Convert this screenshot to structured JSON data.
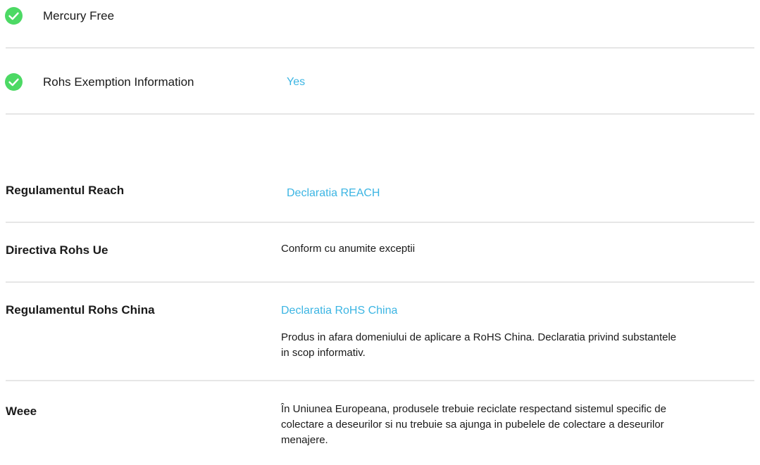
{
  "colors": {
    "check_green": "#4cd964",
    "link": "#3cb5e3",
    "divider": "#e6e6e6"
  },
  "features": [
    {
      "icon": "check-circle-icon",
      "label": "Mercury Free",
      "value": ""
    },
    {
      "icon": "check-circle-icon",
      "label": "Rohs Exemption Information",
      "value": "Yes"
    }
  ],
  "regulations": {
    "reach": {
      "label": "Regulamentul Reach",
      "link": "Declaratia REACH"
    },
    "rohs_eu": {
      "label": "Directiva Rohs Ue",
      "value": "Conform cu anumite exceptii"
    },
    "rohs_china": {
      "label": "Regulamentul Rohs China",
      "link": "Declaratia RoHS China",
      "description_lines": [
        "Produs in afara domeniului de aplicare a RoHS China. Declaratia privind substantele",
        "in scop informativ."
      ]
    },
    "weee": {
      "label": "Weee",
      "description_lines": [
        "În Uniunea Europeana, produsele trebuie reciclate respectand sistemul specific de",
        "colectare a deseurilor si nu trebuie sa ajunga in pubelele de colectare a deseurilor",
        "menajere."
      ]
    }
  }
}
